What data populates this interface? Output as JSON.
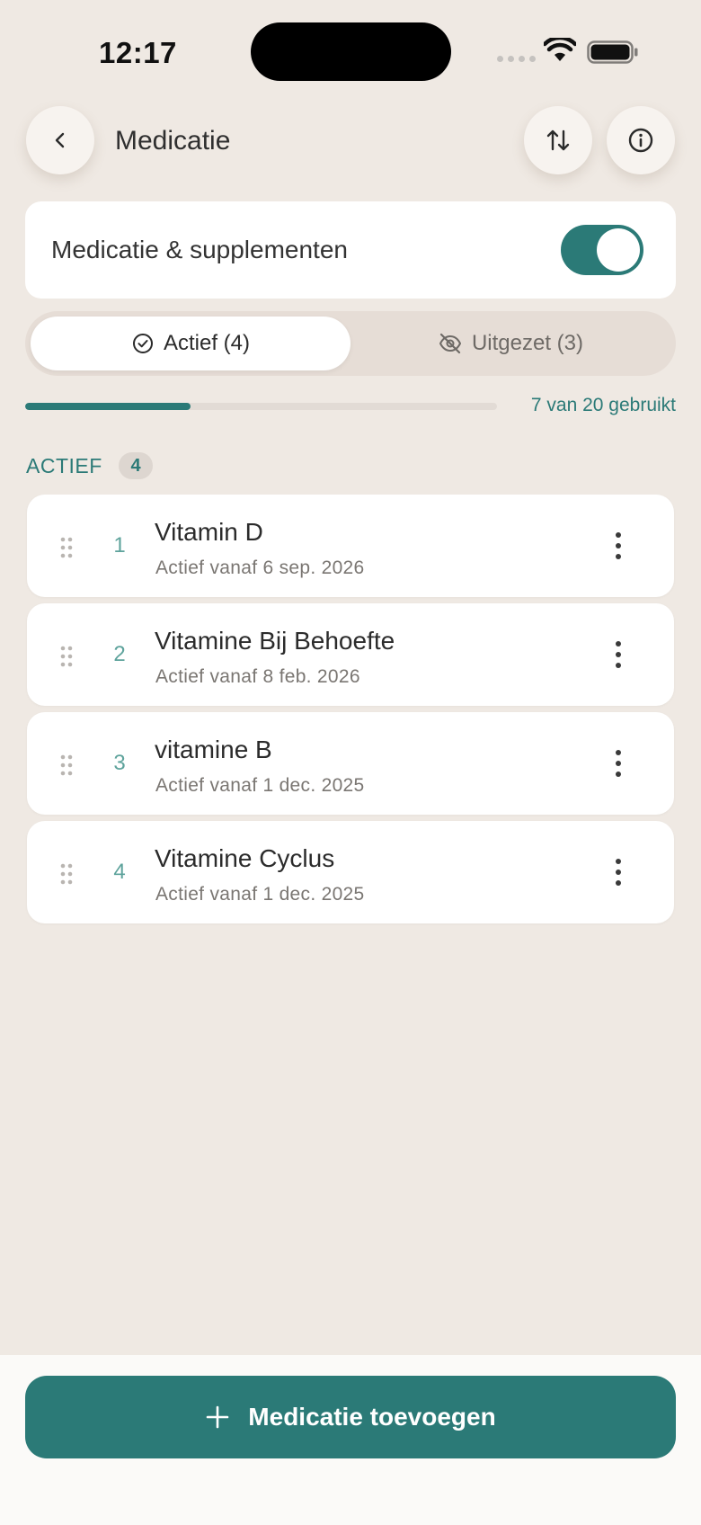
{
  "status_bar": {
    "time": "12:17"
  },
  "header": {
    "title": "Medicatie"
  },
  "toggle_card": {
    "label": "Medicatie & supplementen",
    "enabled": true
  },
  "tabs": [
    {
      "label": "Actief (4)",
      "active": true
    },
    {
      "label": "Uitgezet (3)",
      "active": false
    }
  ],
  "usage": {
    "text": "7 van 20 gebruikt",
    "used": 7,
    "total": 20
  },
  "section": {
    "title": "ACTIEF",
    "count": "4"
  },
  "medications": [
    {
      "index": "1",
      "name": "Vitamin D",
      "subtitle": "Actief vanaf 6 sep. 2026"
    },
    {
      "index": "2",
      "name": "Vitamine Bij Behoefte",
      "subtitle": "Actief vanaf 8 feb. 2026"
    },
    {
      "index": "3",
      "name": "vitamine B",
      "subtitle": "Actief vanaf 1 dec. 2025"
    },
    {
      "index": "4",
      "name": "Vitamine Cyclus",
      "subtitle": "Actief vanaf 1 dec. 2025"
    }
  ],
  "add_button": {
    "label": "Medicatie toevoegen"
  },
  "colors": {
    "accent": "#2b7a77",
    "background": "#efe9e3",
    "index": "#5ea39c"
  },
  "icons": [
    "chevron-left-icon",
    "sort-arrows-icon",
    "info-icon",
    "check-circle-icon",
    "eye-off-icon",
    "drag-handle-icon",
    "more-vertical-icon",
    "plus-icon"
  ]
}
